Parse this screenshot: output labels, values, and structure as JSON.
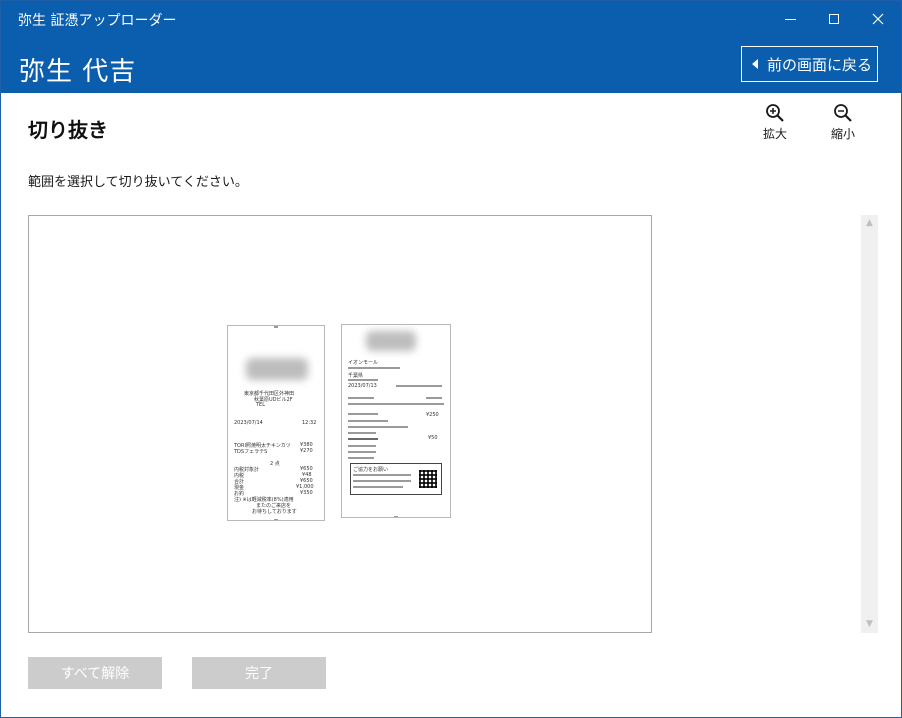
{
  "window": {
    "title": "弥生 証憑アップローダー"
  },
  "header": {
    "company": "弥生 代吉",
    "back_label": "前の画面に戻る"
  },
  "page": {
    "title": "切り抜き",
    "instruction": "範囲を選択して切り抜いてください。"
  },
  "tools": {
    "zoom_in_label": "拡大",
    "zoom_out_label": "縮小"
  },
  "receipt1": {
    "lines": [
      "東京都千代田区外神田",
      "秋葉原UDビル2F",
      "TEL",
      "2023/07/14",
      "12:32",
      "TORI照焼明太チキンカツ",
      "¥380",
      "TDSフェラテS",
      "¥270",
      "2 点",
      "内税対象計",
      "¥650",
      "内税",
      "¥48",
      "合計",
      "¥650",
      "現金",
      "¥1,000",
      "お釣",
      "¥350",
      "注) ※は軽減税率(8%)適用",
      "またのご来店を",
      "お待ちしております"
    ]
  },
  "receipt2": {
    "lines": [
      "イオンモール",
      "千葉県",
      "2023/07/13",
      "¥250",
      "¥50",
      "ご協力をお願い"
    ]
  },
  "buttons": {
    "release_all": "すべて解除",
    "done": "完了"
  },
  "colors": {
    "brand_blue": "#0a5ead",
    "disabled_button": "#cccccc"
  }
}
